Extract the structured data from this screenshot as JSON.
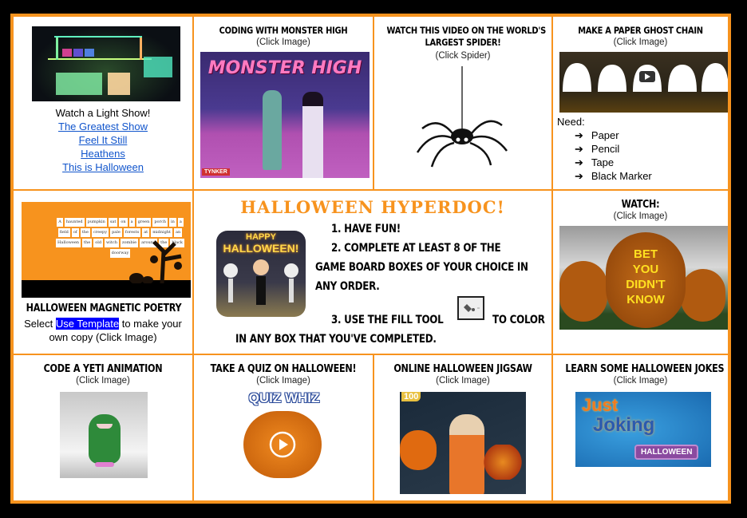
{
  "board": {
    "light_show": {
      "heading": "Watch a Light Show!",
      "links": [
        "The Greatest Show",
        "Feel It Still",
        "Heathens",
        "This is Halloween"
      ]
    },
    "monster_high": {
      "title": "Coding with Monster High",
      "sub": "(Click Image)",
      "image_text": "MONSTER HIGH",
      "badge": "TYNKER"
    },
    "spider": {
      "title_line1": "Watch this video on the world's",
      "title_line2": "largest spider!",
      "sub": "(Click Spider)"
    },
    "ghost_chain": {
      "title": "Make a Paper Ghost Chain",
      "sub": "(Click Image)",
      "need_label": "Need:",
      "arrow": "➔",
      "items": [
        "Paper",
        "Pencil",
        "Tape",
        "Black Marker"
      ]
    },
    "magnetic_poetry": {
      "title": "Halloween Magnetic Poetry",
      "text_before": "Select ",
      "highlight": "Use Template",
      "text_after": " to make your own copy (Click Image)",
      "words": [
        "A",
        "haunted",
        "pumpkin",
        "sat",
        "on",
        "a",
        "green",
        "porch",
        "in",
        "a",
        "field",
        "of",
        "the",
        "creepy",
        "pale",
        "forests",
        "at",
        "midnight",
        "an",
        "Halloween",
        "the",
        "old",
        "witch",
        "zombie",
        "around",
        "the",
        "black",
        "doorway"
      ]
    },
    "hyperdoc": {
      "title": "HALLOWEEN HYPERDOC!",
      "badge_line1": "HAPPY",
      "badge_line2": "HALLOWEEN!",
      "step1": "1.   Have fun!",
      "step2a": "2.  Complete at least 8 of the",
      "step2b": "game board boxes of your choice in",
      "step2c": "any order.",
      "step3a": "3.  Use the fill tool",
      "step3b": "to color",
      "step3c": "in any box that you've completed."
    },
    "watch": {
      "title": "Watch:",
      "sub": "(Click Image)",
      "image_text": [
        "BET",
        "YOU",
        "DIDN'T",
        "KNOW"
      ]
    },
    "yeti": {
      "title": "Code a Yeti Animation",
      "sub": "(Click Image)"
    },
    "quiz": {
      "title": "Take a Quiz on Halloween!",
      "sub": "(Click Image)",
      "image_text": "QUIZ WHIZ"
    },
    "jigsaw": {
      "title": "Online Halloween Jigsaw",
      "sub": "(Click Image)",
      "badge": "100"
    },
    "jokes": {
      "title": "Learn Some Halloween Jokes",
      "sub": "(Click Image)",
      "image_line1": "Just",
      "image_line2": "Joking",
      "image_tag": "HALLOWEEN"
    }
  },
  "colors": {
    "border": "#f7931e",
    "link": "#1155cc",
    "highlight": "#0000ff"
  }
}
